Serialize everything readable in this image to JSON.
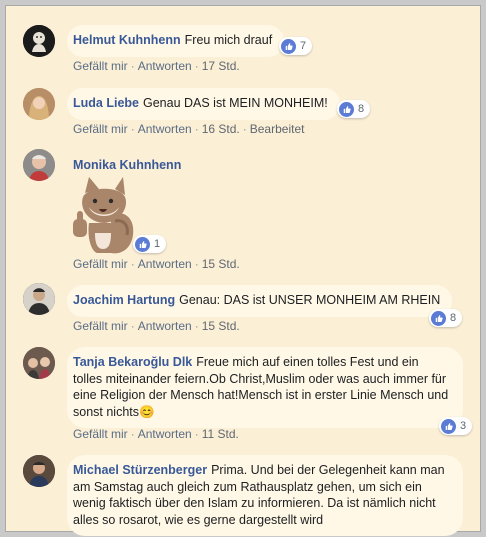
{
  "comments": [
    {
      "author": "Helmut Kuhnhenn",
      "text": "Freu mich drauf",
      "likes": "7",
      "like_label": "Gefällt mir",
      "reply_label": "Antworten",
      "time": "17 Std."
    },
    {
      "author": "Luda Liebe",
      "text": "Genau DAS ist MEIN MONHEIM!",
      "likes": "8",
      "like_label": "Gefällt mir",
      "reply_label": "Antworten",
      "time": "16 Std.",
      "edited": "Bearbeitet"
    },
    {
      "author": "Monika Kuhnhenn",
      "text": "",
      "likes": "1",
      "like_label": "Gefällt mir",
      "reply_label": "Antworten",
      "time": "15 Std."
    },
    {
      "author": "Joachim Hartung",
      "text": "Genau: DAS ist UNSER MONHEIM AM RHEIN",
      "likes": "8",
      "like_label": "Gefällt mir",
      "reply_label": "Antworten",
      "time": "15 Std."
    },
    {
      "author": "Tanja Bekaroğlu Dlk",
      "text": "Freue mich auf einen tolles Fest und ein tolles miteinander feiern.Ob Christ,Muslim oder was auch immer für eine Religion der Mensch hat!Mensch ist in erster Linie Mensch und sonst nichts😊",
      "likes": "3",
      "like_label": "Gefällt mir",
      "reply_label": "Antworten",
      "time": "11 Std."
    },
    {
      "author": "Michael Stürzenberger",
      "text": "Prima. Und bei der Gelegenheit kann man am Samstag auch gleich zum Rathausplatz gehen, um sich ein wenig faktisch über den Islam zu informieren. Da ist nämlich nicht alles so rosarot, wie es gerne dargestellt wird"
    }
  ],
  "colors": {
    "background": "#fbefd6",
    "bubble": "#fff8e6",
    "author": "#385898",
    "like_blue": "#5b7bd5"
  }
}
